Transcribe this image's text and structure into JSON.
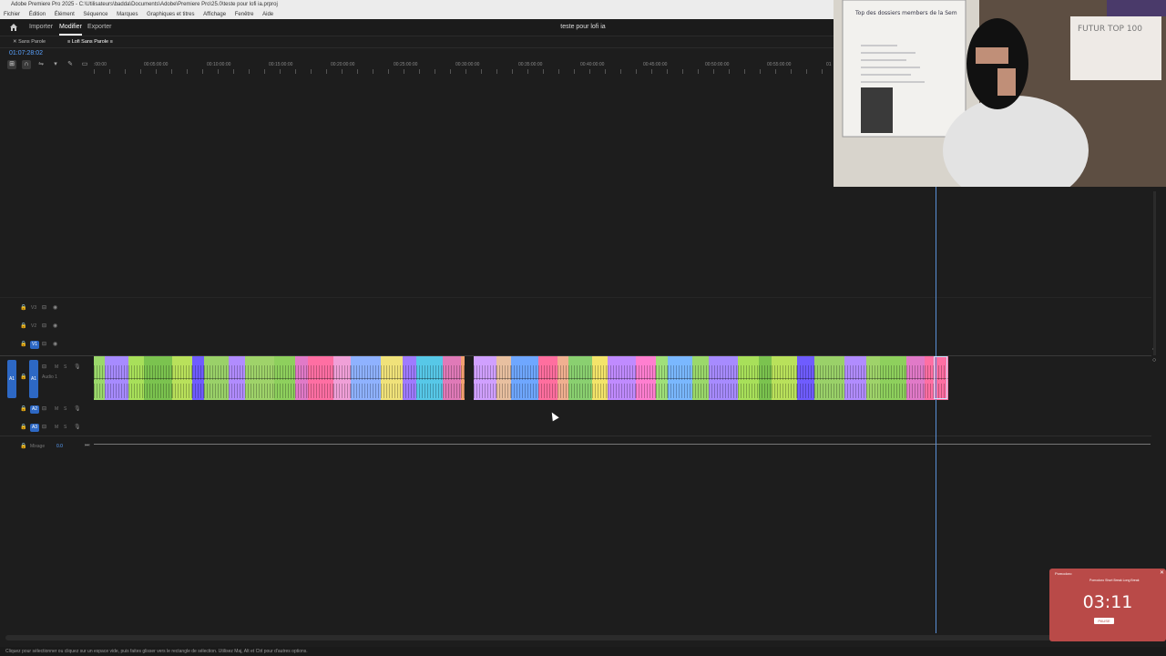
{
  "window": {
    "title": "Adobe Premiere Pro 2025 - C:\\Utilisateurs\\badda\\Documents\\Adobe\\Premiere Pro\\25.0\\teste pour lofi ia.prproj"
  },
  "menu": [
    "Fichier",
    "Édition",
    "Élément",
    "Séquence",
    "Marques",
    "Graphiques et titres",
    "Affichage",
    "Fenêtre",
    "Aide"
  ],
  "header": {
    "home_icon": "home-icon",
    "nav": [
      "Importer",
      "Modifier",
      "Exporter"
    ],
    "active": "Modifier",
    "project_name": "teste pour lofi ia"
  },
  "sequence_tabs": [
    "Sans Parole",
    "Lofi Sans Parole"
  ],
  "timecode": "01:07:28:02",
  "ruler_labels": [
    ":00:00",
    "00:05:00:00",
    "00:10:00:00",
    "00:15:00:00",
    "00:20:00:00",
    "00:25:00:00",
    "00:30:00:00",
    "00:35:00:00",
    "00:40:00:00",
    "00:45:00:00",
    "00:50:00:00",
    "00:55:00:00",
    "01"
  ],
  "tracks": {
    "video": [
      {
        "label": "V3"
      },
      {
        "label": "V2"
      },
      {
        "label": "V1"
      }
    ],
    "audio": [
      {
        "label": "A1",
        "name": "Audio 1",
        "source": "A1"
      },
      {
        "label": "A2"
      },
      {
        "label": "A3"
      }
    ],
    "mix": {
      "label": "Mixage",
      "value": "0.0"
    },
    "letters": {
      "m": "M",
      "s": "S"
    }
  },
  "clip_colors": [
    "#9bd86b",
    "#a78bff",
    "#a8e05a",
    "#7bc34f",
    "#b9e15b",
    "#6f5cff",
    "#9ad169",
    "#b18cff",
    "#9fd36a",
    "#8ed05d",
    "#e17ac8",
    "#ff6fa3",
    "#f0a0d8",
    "#8fb2ff",
    "#f0e27a",
    "#9f7bff",
    "#57c8e8",
    "#e07ab8",
    "#f2a070",
    "#d0a0ff",
    "#e8c0a0",
    "#6fa7ff",
    "#ff6f9f",
    "#f0b090",
    "#8ad070",
    "#f3e46a",
    "#c08bff",
    "#ff7fd0",
    "#9fe07a",
    "#7ab8ff"
  ],
  "status": "Cliquez pour sélectionner ou cliquez sur un espace vide, puis faites glisser vers le rectangle de sélection. Utilisez Maj, Alt et Ctrl pour d'autres options.",
  "timer_widget": {
    "time": "03:11",
    "button": "PAUSE",
    "brand": "Pomodoro",
    "tabs": [
      "Pomodoro",
      "Short Break",
      "Long Break"
    ]
  },
  "webcam": {
    "whiteboard_text": "Top des dossiers members de la Sem",
    "sign_text": "FUTUR TOP 100"
  }
}
